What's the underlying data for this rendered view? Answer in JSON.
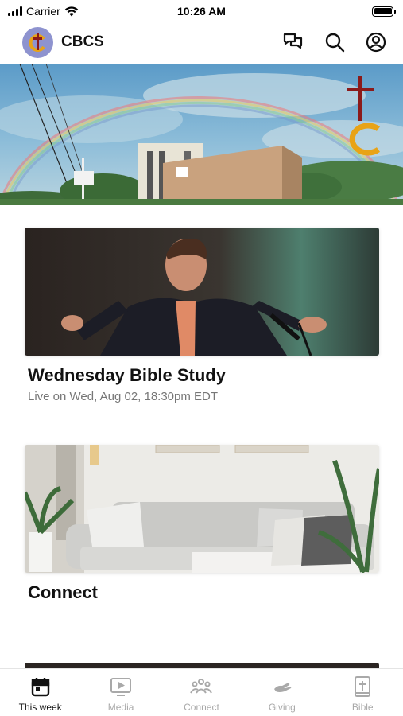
{
  "status_bar": {
    "carrier": "Carrier",
    "time": "10:26 AM"
  },
  "header": {
    "title": "CBCS",
    "icons": [
      "chat-icon",
      "search-icon",
      "account-icon"
    ]
  },
  "hero": {
    "image": "church-building-rainbow"
  },
  "cards": [
    {
      "title": "Wednesday Bible Study",
      "subtitle": "Live on Wed, Aug 02, 18:30pm EDT",
      "image": "preacher-speaking"
    },
    {
      "title": "Connect",
      "subtitle": "",
      "image": "living-room-sofa"
    }
  ],
  "tabs": [
    {
      "label": "This week",
      "icon": "calendar-icon",
      "active": true
    },
    {
      "label": "Media",
      "icon": "play-icon",
      "active": false
    },
    {
      "label": "Connect",
      "icon": "people-icon",
      "active": false
    },
    {
      "label": "Giving",
      "icon": "giving-hand-icon",
      "active": false
    },
    {
      "label": "Bible",
      "icon": "bible-icon",
      "active": false
    }
  ],
  "colors": {
    "active_tab": "#111111",
    "inactive_tab": "#a9a9a9",
    "avatar_bg": "#8e93cf",
    "logo_cross": "#8b1a1a",
    "logo_gold": "#e8a317"
  }
}
